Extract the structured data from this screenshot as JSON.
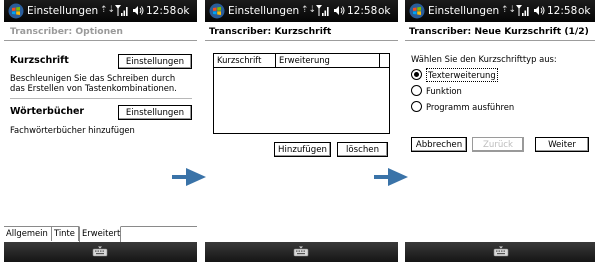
{
  "statusbar": {
    "title": "Einstellungen",
    "sync_glyph": "⇡⇣",
    "time": "12:58",
    "ok": "ok"
  },
  "screen1": {
    "header": "Transcriber: Optionen",
    "kurzschrift_title": "Kurzschrift",
    "kurzschrift_button": "Einstellungen",
    "kurzschrift_desc_line1": "Beschleunigen Sie das Schreiben durch",
    "kurzschrift_desc_line2": "das Erstellen von Tastenkombinationen.",
    "woerterbuecher_title": "Wörterbücher",
    "woerterbuecher_button": "Einstellungen",
    "woerterbuecher_desc": "Fachwörterbücher hinzufügen",
    "tabs": [
      "Allgemein",
      "Tinte",
      "Erweitert"
    ],
    "active_tab": "Erweitert"
  },
  "screen2": {
    "header": "Transcriber: Kurzschrift",
    "columns": [
      "Kurzschrift",
      "Erweiterung"
    ],
    "rows": [],
    "add_button": "Hinzufügen",
    "delete_button": "löschen"
  },
  "screen3": {
    "header": "Transcriber: Neue Kurzschrift (1/2)",
    "prompt": "Wählen Sie den Kurzschrifttyp aus:",
    "options": [
      "Texterweiterung",
      "Funktion",
      "Programm ausführen"
    ],
    "selected_option": "Texterweiterung",
    "cancel_button": "Abbrechen",
    "back_button": "Zurück",
    "next_button": "Weiter"
  },
  "icons": {
    "start": "windows-flag-icon",
    "signal": "signal-strength-icon",
    "volume": "speaker-icon",
    "keyboard": "keyboard-icon",
    "arrow": "right-arrow-icon"
  },
  "colors": {
    "titlebar": "#0a0a0a",
    "arrow": "#3a73a8",
    "softbar": "#222222"
  }
}
